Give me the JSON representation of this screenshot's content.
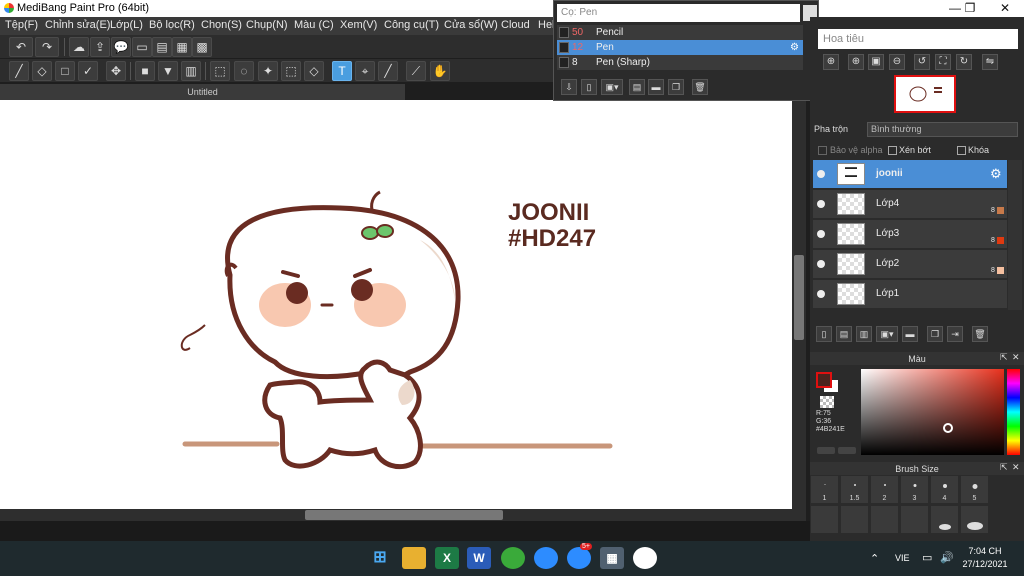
{
  "window": {
    "title": "MediBang Paint Pro (64bit)",
    "minimize": "—",
    "maximize": "❐",
    "close": "✕"
  },
  "menu": [
    "Tệp(F)",
    "Chỉnh sửa(E)",
    "Lớp(L)",
    "Bộ lọc(R)",
    "Chọn(S)",
    "Chụp(N)",
    "Màu (C)",
    "Xem(V)",
    "Công cụ(T)",
    "Cửa sổ(W)",
    "Cloud",
    "Hel"
  ],
  "canvas_tab": "Untitled",
  "artwork_text": [
    "JOONII",
    "#HD247"
  ],
  "brush_popup": {
    "placeholder": "Cọ: Pen",
    "brushes": [
      {
        "size": "50",
        "name": "Pencil",
        "selected": false
      },
      {
        "size": "12",
        "name": "Pen",
        "selected": true
      },
      {
        "size": "8",
        "name": "Pen (Sharp)",
        "selected": false
      }
    ]
  },
  "navigator": {
    "title": "Hoa tiêu"
  },
  "layers_panel": {
    "blend_label": "Pha trộn",
    "blend_value": "Bình thường",
    "protect_alpha": "Bảo vệ alpha",
    "clip": "Xén bớt",
    "lock": "Khóa",
    "layers": [
      {
        "name": "joonii",
        "opacity": "",
        "color": "",
        "selected": true
      },
      {
        "name": "Lớp4",
        "opacity": "8",
        "color": "#c87a4a",
        "selected": false
      },
      {
        "name": "Lớp3",
        "opacity": "8",
        "color": "#e03a10",
        "selected": false
      },
      {
        "name": "Lớp2",
        "opacity": "8",
        "color": "#f5c0a0",
        "selected": false
      },
      {
        "name": "Lớp1",
        "opacity": "",
        "color": "",
        "selected": false
      }
    ]
  },
  "color_panel": {
    "title": "Màu",
    "r": "R:75",
    "g": "G:36",
    "hex": "#4B241E",
    "fg": "#4B241E"
  },
  "brush_size_panel": {
    "title": "Brush Size",
    "sizes": [
      "1",
      "1.5",
      "2",
      "3",
      "4",
      "5"
    ]
  },
  "taskbar": {
    "lang": "VIE",
    "time": "7:04 CH",
    "date": "27/12/2021",
    "badge": "5+"
  },
  "colors": {
    "accent": "#4a8ed6",
    "line_art": "#6a2c22",
    "blush": "#f8c8b0",
    "leaf": "#6cc56c",
    "ground": "#c8967a"
  }
}
